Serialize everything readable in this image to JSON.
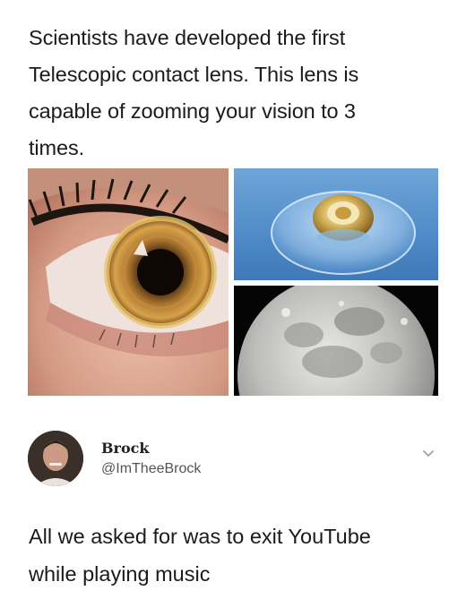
{
  "post": {
    "caption": "Scientists have developed the first\nTelescopic contact lens. This lens is\ncapable of zooming your vision to 3\ntimes.",
    "images": [
      {
        "icon": "eye-with-lens-photo"
      },
      {
        "icon": "telescopic-contact-lens-photo"
      },
      {
        "icon": "moon-photo"
      }
    ]
  },
  "tweet": {
    "name": "Brock",
    "handle": "@ImTheeBrock",
    "text": "All we asked for was to exit YouTube\nwhile playing music",
    "menu_icon": "chevron-down-icon"
  }
}
